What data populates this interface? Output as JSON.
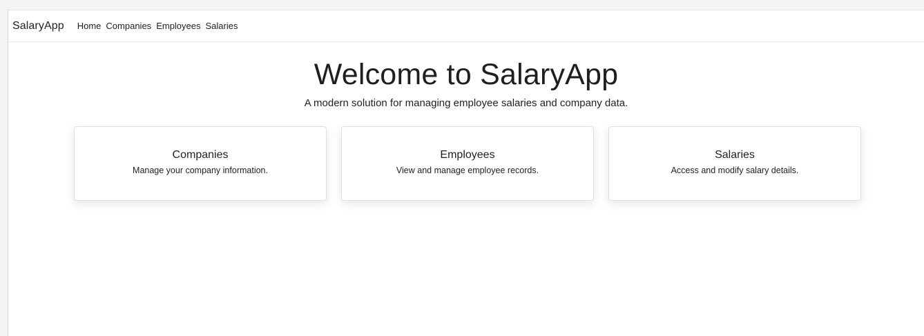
{
  "navbar": {
    "brand": "SalaryApp",
    "links": [
      {
        "label": "Home"
      },
      {
        "label": "Companies"
      },
      {
        "label": "Employees"
      },
      {
        "label": "Salaries"
      }
    ]
  },
  "hero": {
    "title": "Welcome to SalaryApp",
    "subtitle": "A modern solution for managing employee salaries and company data."
  },
  "cards": [
    {
      "title": "Companies",
      "text": "Manage your company information."
    },
    {
      "title": "Employees",
      "text": "View and manage employee records."
    },
    {
      "title": "Salaries",
      "text": "Access and modify salary details."
    }
  ]
}
